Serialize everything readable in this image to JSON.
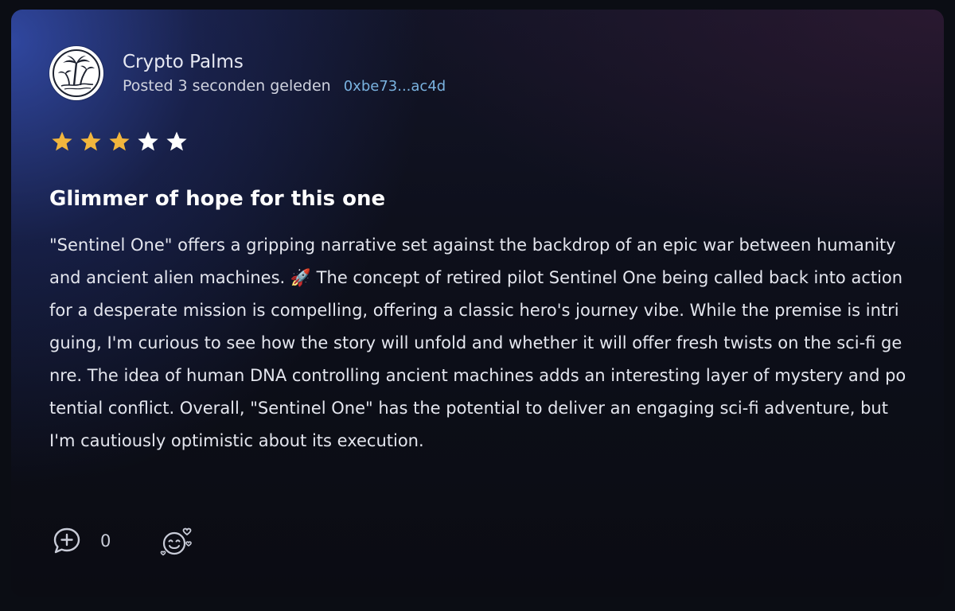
{
  "review": {
    "author": "Crypto Palms",
    "posted": "Posted 3 seconden geleden",
    "wallet": "0xbe73...ac4d",
    "rating": 3,
    "max_rating": 5,
    "title": "Glimmer of hope for this one",
    "body": "\"Sentinel One\" offers a gripping narrative set against the backdrop of an epic war between humanity and ancient alien machines. 🚀 The concept of retired pilot Sentinel One being called back into action for a desperate mission is compelling, offering a classic hero's journey vibe. While the premise is intriguing, I'm curious to see how the story will unfold and whether it will offer fresh twists on the sci-fi genre. The idea of human DNA controlling ancient machines adds an interesting layer of mystery and potential conflict. Overall, \"Sentinel One\" has the potential to deliver an engaging sci-fi adventure, but I'm cautiously optimistic about its execution.",
    "comment_count": "0"
  },
  "colors": {
    "star_filled": "#f2b63d",
    "star_empty": "#ffffff",
    "wallet_link": "#7ab3e0"
  },
  "icons": {
    "avatar": "palm-trees-logo-icon",
    "comment": "comment-plus-icon",
    "react": "smile-hearts-icon"
  }
}
